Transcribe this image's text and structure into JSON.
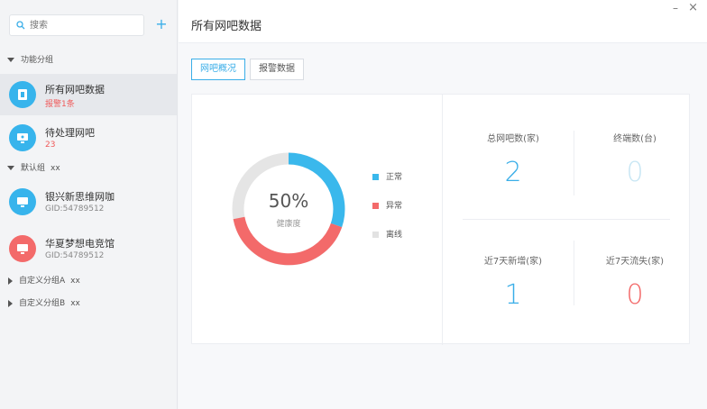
{
  "colors": {
    "accent": "#3aaee8",
    "alert": "#f36a6a",
    "offline": "#e5e5e5",
    "value_muted": "#c8e6f4"
  },
  "sidebar": {
    "search_placeholder": "搜索",
    "add_label": "+",
    "groups": {
      "function": {
        "label": "功能分组"
      },
      "default": {
        "label": "默认组",
        "count": "xx"
      },
      "custom_a": {
        "label": "自定义分组A",
        "count": "xx"
      },
      "custom_b": {
        "label": "自定义分组B",
        "count": "xx"
      }
    },
    "items": [
      {
        "title": "所有网吧数据",
        "sub": "报警1条",
        "icon": "cafe-icon"
      },
      {
        "title": "待处理网吧",
        "sub": "23",
        "icon": "monitor-icon"
      },
      {
        "title": "银兴新思维网咖",
        "sub": "GID:54789512",
        "icon": "monitor-icon"
      },
      {
        "title": "华夏梦想电竞馆",
        "sub": "GID:54789512",
        "icon": "monitor-icon"
      }
    ]
  },
  "header": {
    "title": "所有网吧数据",
    "minimize": "–",
    "close": "×"
  },
  "tabs": [
    {
      "label": "网吧概况"
    },
    {
      "label": "报警数据"
    }
  ],
  "overview": {
    "ratio_text": "50%",
    "ratio_sub": "健康度",
    "legend": [
      {
        "label": "正常"
      },
      {
        "label": "异常"
      },
      {
        "label": "离线"
      }
    ]
  },
  "stats": {
    "total_cafes": {
      "label": "总网吧数(家)",
      "value": "2"
    },
    "terminals": {
      "label": "终端数(台)",
      "value": "0"
    },
    "new_7d": {
      "label": "近7天新增(家)",
      "value": "1"
    },
    "lost_7d": {
      "label": "近7天流失(家)",
      "value": "0"
    }
  }
}
